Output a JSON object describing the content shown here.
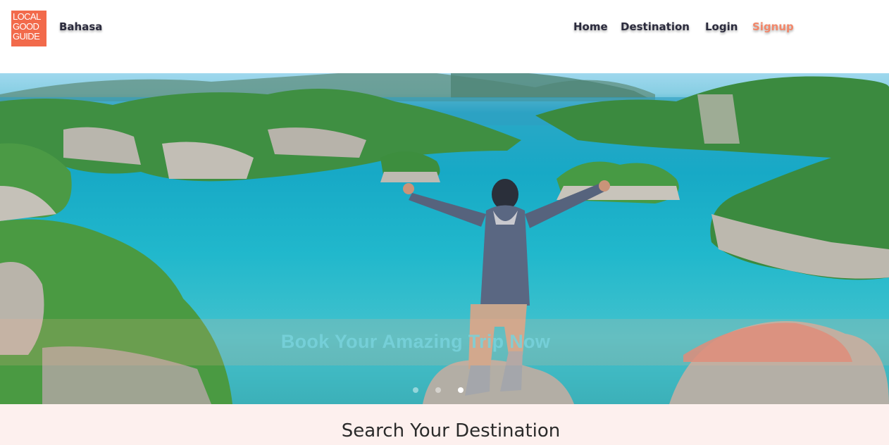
{
  "header": {
    "logo_lines": [
      "LOCAL",
      "GOOD",
      "GUIDE"
    ],
    "language": "Bahasa",
    "nav": {
      "home": "Home",
      "destination": "Destination",
      "login": "Login",
      "signup": "Signup"
    }
  },
  "hero": {
    "cta": "Book Your Amazing Trip Now",
    "slides_count": 3,
    "active_slide": 3
  },
  "search": {
    "title": "Search Your Destination"
  },
  "colors": {
    "accent": "#f26a4b",
    "signup": "#f2876a",
    "nav_text": "#2b2b3d",
    "search_bg": "#fdf0ee"
  }
}
